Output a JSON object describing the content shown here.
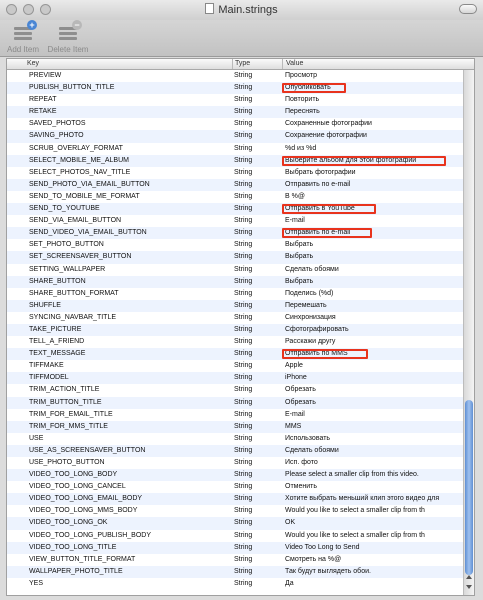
{
  "window": {
    "title": "Main.strings"
  },
  "toolbar": {
    "add_label": "Add Item",
    "delete_label": "Delete Item"
  },
  "columns": {
    "key": "Key",
    "type": "Type",
    "value": "Value"
  },
  "highlight_color": "#e8331d",
  "rows": [
    {
      "key": "PREVIEW",
      "type": "String",
      "value": "Просмотр"
    },
    {
      "key": "PUBLISH_BUTTON_TITLE",
      "type": "String",
      "value": "Опубликовать"
    },
    {
      "key": "REPEAT",
      "type": "String",
      "value": "Повторить"
    },
    {
      "key": "RETAKE",
      "type": "String",
      "value": "Переснять"
    },
    {
      "key": "SAVED_PHOTOS",
      "type": "String",
      "value": "Сохраненные фотографии"
    },
    {
      "key": "SAVING_PHOTO",
      "type": "String",
      "value": "Сохранение фотографии"
    },
    {
      "key": "SCRUB_OVERLAY_FORMAT",
      "type": "String",
      "value": "%d из %d"
    },
    {
      "key": "SELECT_MOBILE_ME_ALBUM",
      "type": "String",
      "value": "Выберите альбом для этой фотографии"
    },
    {
      "key": "SELECT_PHOTOS_NAV_TITLE",
      "type": "String",
      "value": "Выбрать фотографии"
    },
    {
      "key": "SEND_PHOTO_VIA_EMAIL_BUTTON",
      "type": "String",
      "value": "Отправить по e-mail"
    },
    {
      "key": "SEND_TO_MOBILE_ME_FORMAT",
      "type": "String",
      "value": "В %@"
    },
    {
      "key": "SEND_TO_YOUTUBE",
      "type": "String",
      "value": "Отправить в YouTube"
    },
    {
      "key": "SEND_VIA_EMAIL_BUTTON",
      "type": "String",
      "value": "E-mail"
    },
    {
      "key": "SEND_VIDEO_VIA_EMAIL_BUTTON",
      "type": "String",
      "value": "Отправить по e-mail"
    },
    {
      "key": "SET_PHOTO_BUTTON",
      "type": "String",
      "value": "Выбрать"
    },
    {
      "key": "SET_SCREENSAVER_BUTTON",
      "type": "String",
      "value": "Выбрать"
    },
    {
      "key": "SETTING_WALLPAPER",
      "type": "String",
      "value": "Сделать обоями"
    },
    {
      "key": "SHARE_BUTTON",
      "type": "String",
      "value": "Выбрать"
    },
    {
      "key": "SHARE_BUTTON_FORMAT",
      "type": "String",
      "value": "Поделись (%d)"
    },
    {
      "key": "SHUFFLE",
      "type": "String",
      "value": "Перемешать"
    },
    {
      "key": "SYNCING_NAVBAR_TITLE",
      "type": "String",
      "value": "Синхронизация"
    },
    {
      "key": "TAKE_PICTURE",
      "type": "String",
      "value": "Сфотографировать"
    },
    {
      "key": "TELL_A_FRIEND",
      "type": "String",
      "value": "Расскажи другу"
    },
    {
      "key": "TEXT_MESSAGE",
      "type": "String",
      "value": "Отправить по MMS"
    },
    {
      "key": "TIFFMAKE",
      "type": "String",
      "value": "Apple"
    },
    {
      "key": "TIFFMODEL",
      "type": "String",
      "value": "iPhone"
    },
    {
      "key": "TRIM_ACTION_TITLE",
      "type": "String",
      "value": "Обрезать"
    },
    {
      "key": "TRIM_BUTTON_TITLE",
      "type": "String",
      "value": "Обрезать"
    },
    {
      "key": "TRIM_FOR_EMAIL_TITLE",
      "type": "String",
      "value": "E-mail"
    },
    {
      "key": "TRIM_FOR_MMS_TITLE",
      "type": "String",
      "value": "MMS"
    },
    {
      "key": "USE",
      "type": "String",
      "value": "Использовать"
    },
    {
      "key": "USE_AS_SCREENSAVER_BUTTON",
      "type": "String",
      "value": "Сделать обоями"
    },
    {
      "key": "USE_PHOTO_BUTTON",
      "type": "String",
      "value": "Исп. фото"
    },
    {
      "key": "VIDEO_TOO_LONG_BODY",
      "type": "String",
      "value": "Please select a smaller clip from this video."
    },
    {
      "key": "VIDEO_TOO_LONG_CANCEL",
      "type": "String",
      "value": "Отменить"
    },
    {
      "key": "VIDEO_TOO_LONG_EMAIL_BODY",
      "type": "String",
      "value": "Хотите выбрать меньший клип этого видео для"
    },
    {
      "key": "VIDEO_TOO_LONG_MMS_BODY",
      "type": "String",
      "value": "Would you like to select a smaller clip from th"
    },
    {
      "key": "VIDEO_TOO_LONG_OK",
      "type": "String",
      "value": "OK"
    },
    {
      "key": "VIDEO_TOO_LONG_PUBLISH_BODY",
      "type": "String",
      "value": "Would you like to select a smaller clip from th"
    },
    {
      "key": "VIDEO_TOO_LONG_TITLE",
      "type": "String",
      "value": "Video Too Long to Send"
    },
    {
      "key": "VIEW_BUTTON_TITLE_FORMAT",
      "type": "String",
      "value": "Смотреть на %@"
    },
    {
      "key": "WALLPAPER_PHOTO_TITLE",
      "type": "String",
      "value": "Так будут выглядеть обои."
    },
    {
      "key": "YES",
      "type": "String",
      "value": "Да"
    }
  ],
  "highlighted_rows": [
    1,
    7,
    11,
    13,
    23
  ]
}
